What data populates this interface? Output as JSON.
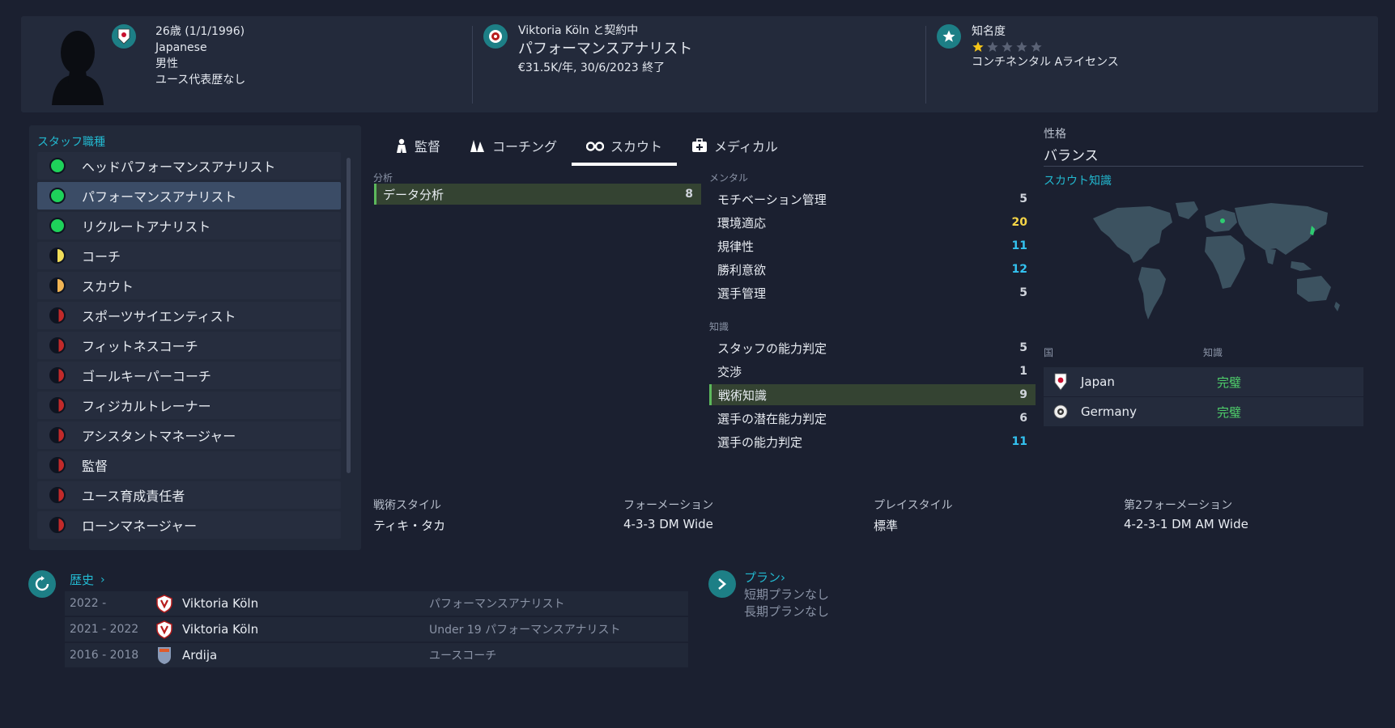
{
  "header": {
    "age_dob": "26歳 (1/1/1996)",
    "nationality": "Japanese",
    "gender": "男性",
    "youth_caps": "ユース代表歴なし",
    "contract_club": "Viktoria Köln と契約中",
    "job": "パフォーマンスアナリスト",
    "salary": "€31.5K/年, 30/6/2023 終了",
    "reputation_label": "知名度",
    "reputation_stars": 1,
    "reputation_max": 5,
    "license": "コンチネンタル Aライセンス"
  },
  "roles": {
    "title": "スタッフ職種",
    "items": [
      {
        "label": "ヘッドパフォーマンスアナリスト",
        "suit": "green",
        "selected": false
      },
      {
        "label": "パフォーマンスアナリスト",
        "suit": "green",
        "selected": true
      },
      {
        "label": "リクルートアナリスト",
        "suit": "green",
        "selected": false
      },
      {
        "label": "コーチ",
        "suit": "half-y",
        "selected": false
      },
      {
        "label": "スカウト",
        "suit": "half-o",
        "selected": false
      },
      {
        "label": "スポーツサイエンティスト",
        "suit": "low",
        "selected": false
      },
      {
        "label": "フィットネスコーチ",
        "suit": "low",
        "selected": false
      },
      {
        "label": "ゴールキーパーコーチ",
        "suit": "low",
        "selected": false
      },
      {
        "label": "フィジカルトレーナー",
        "suit": "low",
        "selected": false
      },
      {
        "label": "アシスタントマネージャー",
        "suit": "low",
        "selected": false
      },
      {
        "label": "監督",
        "suit": "low",
        "selected": false
      },
      {
        "label": "ユース育成責任者",
        "suit": "low",
        "selected": false
      },
      {
        "label": "ローンマネージャー",
        "suit": "low",
        "selected": false
      }
    ]
  },
  "tabs": [
    {
      "label": "監督",
      "icon": "person-icon",
      "active": false
    },
    {
      "label": "コーチング",
      "icon": "cones-icon",
      "active": false
    },
    {
      "label": "スカウト",
      "icon": "binoculars-icon",
      "active": true
    },
    {
      "label": "メディカル",
      "icon": "medical-kit-icon",
      "active": false
    }
  ],
  "analysis": {
    "label": "分析",
    "rows": [
      {
        "name": "データ分析",
        "value": "8",
        "highlight": true
      }
    ]
  },
  "mental": {
    "label": "メンタル",
    "rows": [
      {
        "name": "モチベーション管理",
        "value": "5",
        "color": "normal"
      },
      {
        "name": "環境適応",
        "value": "20",
        "color": "yellow"
      },
      {
        "name": "規律性",
        "value": "11",
        "color": "cyan"
      },
      {
        "name": "勝利意欲",
        "value": "12",
        "color": "cyan"
      },
      {
        "name": "選手管理",
        "value": "5",
        "color": "normal"
      }
    ]
  },
  "knowledge": {
    "label": "知識",
    "rows": [
      {
        "name": "スタッフの能力判定",
        "value": "5",
        "color": "normal"
      },
      {
        "name": "交渉",
        "value": "1",
        "color": "normal"
      },
      {
        "name": "戦術知識",
        "value": "9",
        "color": "normal",
        "highlight": true
      },
      {
        "name": "選手の潜在能力判定",
        "value": "6",
        "color": "normal"
      },
      {
        "name": "選手の能力判定",
        "value": "11",
        "color": "cyan"
      }
    ]
  },
  "styles": [
    {
      "label": "戦術スタイル",
      "value": "ティキ・タカ"
    },
    {
      "label": "フォーメーション",
      "value": "4-3-3 DM Wide"
    },
    {
      "label": "プレイスタイル",
      "value": "標準"
    },
    {
      "label": "第2フォーメーション",
      "value": "4-2-3-1 DM AM Wide"
    }
  ],
  "personality": {
    "label": "性格",
    "value": "バランス"
  },
  "scout_knowledge": {
    "title": "スカウト知識",
    "col_country": "国",
    "col_knowledge": "知識",
    "rows": [
      {
        "country": "Japan",
        "level": "完璧"
      },
      {
        "country": "Germany",
        "level": "完璧"
      }
    ]
  },
  "history": {
    "title": "歴史",
    "rows": [
      {
        "years": "2022 -",
        "club": "Viktoria Köln",
        "role": "パフォーマンスアナリスト"
      },
      {
        "years": "2021 - 2022",
        "club": "Viktoria Köln",
        "role": "Under 19 パフォーマンスアナリスト"
      },
      {
        "years": "2016 - 2018",
        "club": "Ardija",
        "role": "ユースコーチ"
      }
    ]
  },
  "plans": {
    "title": "プラン",
    "short": "短期プランなし",
    "long": "長期プランなし"
  },
  "colors": {
    "background": "#1b2030",
    "accent": "#22b8cf",
    "suit_green": "#1ed25a",
    "perfect_green": "#4fd16b",
    "value_yellow": "#f5d547",
    "value_cyan": "#33c2f0"
  }
}
